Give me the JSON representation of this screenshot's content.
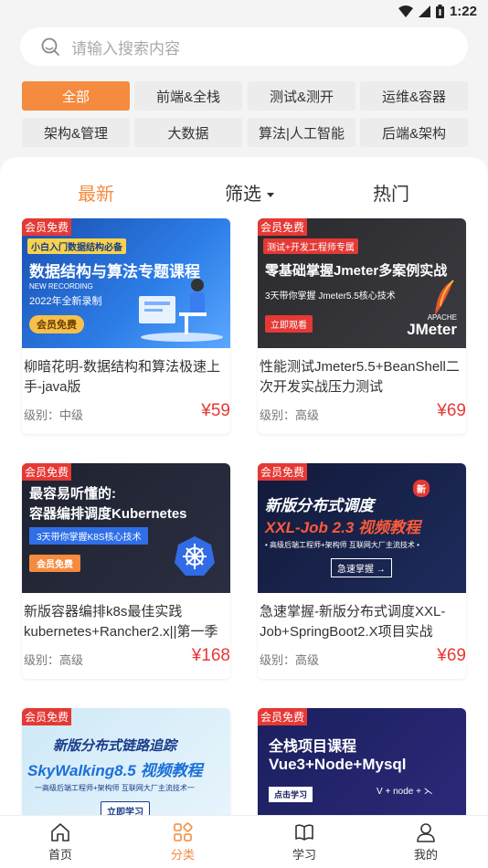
{
  "status": {
    "time": "1:22"
  },
  "search": {
    "placeholder": "请输入搜索内容"
  },
  "categories": [
    {
      "label": "全部",
      "active": true
    },
    {
      "label": "前端&全栈",
      "active": false
    },
    {
      "label": "测试&测开",
      "active": false
    },
    {
      "label": "运维&容器",
      "active": false
    },
    {
      "label": "架构&管理",
      "active": false
    },
    {
      "label": "大数据",
      "active": false
    },
    {
      "label": "算法|人工智能",
      "active": false
    },
    {
      "label": "后端&架构",
      "active": false
    }
  ],
  "tabs": {
    "latest": "最新",
    "filter": "筛选",
    "hot": "热门"
  },
  "courses": [
    {
      "badge": "会员免费",
      "thumb_tag": "小白入门数据结构必备",
      "thumb_title": "数据结构与算法专题课程",
      "thumb_sub1": "NEW RECORDING",
      "thumb_sub2": "2022年全新录制",
      "thumb_btn": "会员免费",
      "title": "柳暗花明-数据结构和算法极速上手-java版",
      "level": "级别：中级",
      "price": "¥59"
    },
    {
      "badge": "会员免费",
      "thumb_tag": "测试+开发工程师专属",
      "thumb_title": "零基础掌握Jmeter多案例实战",
      "thumb_sub1": "3天带你掌握 Jmeter5.5核心技术",
      "thumb_sub2": "APACHE",
      "thumb_btn": "立即观看",
      "thumb_logo": "JMeter",
      "title": "性能测试Jmeter5.5+BeanShell二次开发实战压力测试",
      "level": "级别：高级",
      "price": "¥69"
    },
    {
      "badge": "会员免费",
      "thumb_title": "最容易听懂的:",
      "thumb_title2": "容器编排调度Kubernetes",
      "thumb_sub1": "3天带你掌握K8S核心技术",
      "thumb_btn": "会员免费",
      "title": "新版容器编排k8s最佳实践kubernetes+Rancher2.x||第一季",
      "level": "级别：高级",
      "price": "¥168"
    },
    {
      "badge": "会员免费",
      "thumb_tag": "新",
      "thumb_title": "新版分布式调度",
      "thumb_title2": "XXL-Job 2.3 视频教程",
      "thumb_sub1": "• 高级后端工程师+架构师 互联网大厂主流技术 •",
      "thumb_btn": "急速掌握 →",
      "title": "急速掌握-新版分布式调度XXL-Job+SpringBoot2.X项目实战",
      "level": "级别：高级",
      "price": "¥69"
    },
    {
      "badge": "会员免费",
      "thumb_title": "新版分布式链路追踪",
      "thumb_title2": "SkyWalking8.5 视频教程",
      "thumb_sub1": "一高级后端工程师+架构师 互联网大厂主流技术一",
      "thumb_btn": "立即学习"
    },
    {
      "badge": "会员免费",
      "thumb_title": "全栈项目课程",
      "thumb_title2": "Vue3+Node+Mysql",
      "thumb_btn": "点击学习",
      "thumb_logo": "V + node + ⋋"
    }
  ],
  "nav": [
    {
      "label": "首页",
      "icon": "home-icon",
      "active": false
    },
    {
      "label": "分类",
      "icon": "category-icon",
      "active": true
    },
    {
      "label": "学习",
      "icon": "book-icon",
      "active": false
    },
    {
      "label": "我的",
      "icon": "user-icon",
      "active": false
    }
  ],
  "colors": {
    "accent": "#f58b3f",
    "price": "#e53935"
  }
}
